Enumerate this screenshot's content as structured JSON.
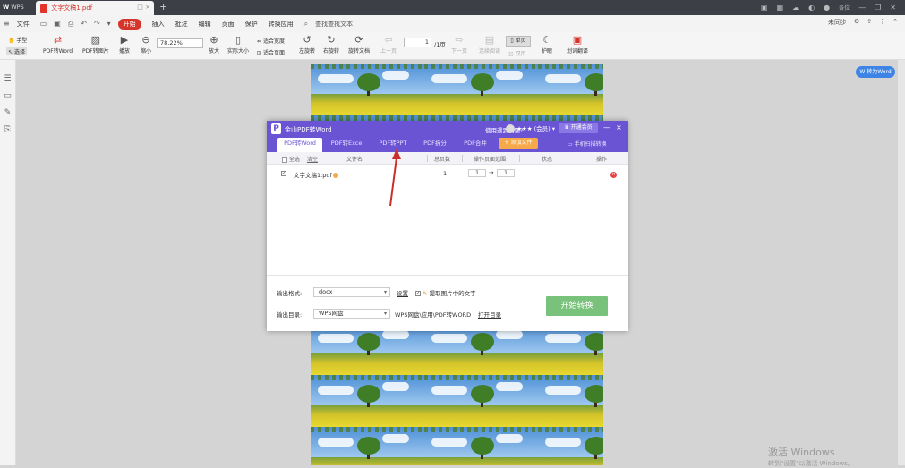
{
  "titlebar": {
    "app_label": "WPS",
    "doc_tab_name": "文字文稿1.pdf",
    "tab_controls": "□ ×",
    "new_tab": "+",
    "user_name": "各位"
  },
  "menubar": {
    "file": "文件",
    "tabs": [
      "开始",
      "插入",
      "批注",
      "编辑",
      "页面",
      "保护",
      "转换应用"
    ],
    "search": "查找查找文本",
    "right_sync": "未同步"
  },
  "ribbon": {
    "hand": "手型",
    "select": "选择",
    "pdf_to_word": "PDF转Word",
    "pdf_to_image": "PDF转图片",
    "play": "播放",
    "zoom_out": "缩小",
    "zoom_value": "78.22%",
    "zoom_in": "放大",
    "actual_size": "实际大小",
    "fit_width": "适合宽度",
    "fit_page": "适合页面",
    "rotate_left": "左旋转",
    "rotate_right": "右旋转",
    "rotate_doc": "旋转文档",
    "prev_page": "上一页",
    "page_current": "1",
    "page_total": "/1页",
    "next_page": "下一页",
    "continuous": "连续阅读",
    "single": "单页",
    "double": "双页",
    "night": "护眼",
    "translate": "划词翻译"
  },
  "float_button": "转为Word",
  "watermark": {
    "line1": "激活 Windows",
    "line2": "转到\"设置\"以激活 Windows。"
  },
  "dialog": {
    "title": "金山PDF转Word",
    "help": "使用遇到问题?",
    "user": "★★★ (会员) ▾",
    "vip": "开通会员",
    "minimize": "—",
    "close": "×",
    "tabs": [
      "PDF转Word",
      "PDF转Excel",
      "PDF转PPT",
      "PDF拆分",
      "PDF合并"
    ],
    "add_file": "+ 添加文件",
    "mobile_link": "手机扫描转换",
    "headers": {
      "select_all": "全选",
      "clear": "清空",
      "filename": "文件名",
      "total_pages": "总页数",
      "page_range": "操作页面范围",
      "status": "状态",
      "action": "操作"
    },
    "file_row": {
      "name": "文字文稿1.pdf",
      "pages": "1",
      "range_from": "1",
      "range_arrow": "→",
      "range_to": "1"
    },
    "output_format_label": "输出格式:",
    "output_format_value": "docx",
    "settings_link": "设置",
    "extract_text_label": "提取图片中的文字",
    "output_dir_label": "输出目录:",
    "output_dir_value": "WPS网盘",
    "output_path": "WPS网盘\\应用\\PDF转WORD",
    "open_dir_link": "打开目录",
    "start_button": "开始转换"
  }
}
